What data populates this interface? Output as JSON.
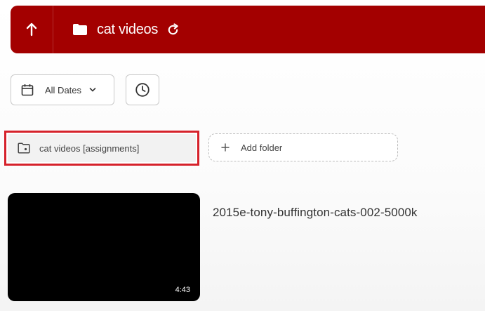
{
  "header": {
    "title": "cat videos",
    "background": "#a30000",
    "icons": {
      "up": "arrow-up-icon",
      "folder": "folder-icon",
      "refresh": "refresh-icon"
    }
  },
  "filters": {
    "dates_label": "All Dates",
    "icons": {
      "calendar": "calendar-icon",
      "chevron": "chevron-down-icon",
      "clock": "clock-icon"
    }
  },
  "folders": {
    "items": [
      {
        "label": "cat videos [assignments]",
        "selected": true,
        "icon": "folder-icon"
      }
    ],
    "add_label": "Add folder",
    "highlight_color": "#d6222b"
  },
  "videos": [
    {
      "title": "2015e-tony-buffington-cats-002-5000k",
      "duration": "4:43"
    }
  ]
}
